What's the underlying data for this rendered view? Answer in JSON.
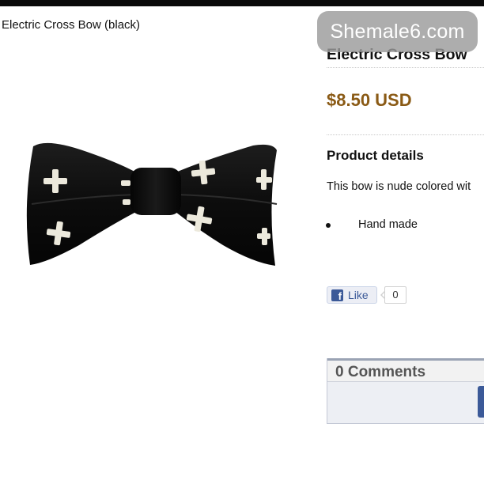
{
  "image_caption": "Electric Cross Bow (black)",
  "watermark": "Shemale6.com",
  "product": {
    "title": "Electric Cross Bow",
    "price": "$8.50 USD",
    "details_heading": "Product details",
    "description": "This bow is nude colored wit",
    "bullets": [
      "Hand made"
    ]
  },
  "social": {
    "like_label": "Like",
    "like_count": "0",
    "fb_glyph": "f"
  },
  "comments": {
    "title": "0 Comments"
  },
  "colors": {
    "price": "#8a5a15",
    "facebook": "#3b5998",
    "watermark_bg": "#9b9b9b"
  },
  "icons": [
    "facebook-icon",
    "bullet-icon"
  ]
}
